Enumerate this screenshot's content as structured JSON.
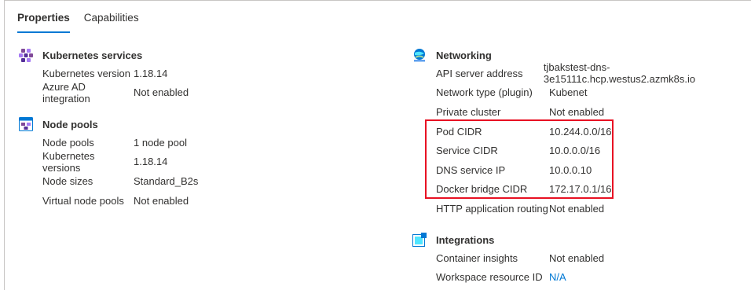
{
  "tabs": [
    {
      "label": "Properties",
      "active": true
    },
    {
      "label": "Capabilities",
      "active": false
    }
  ],
  "kubernetes_services": {
    "title": "Kubernetes services",
    "icon": "kubernetes-services-icon",
    "rows": [
      {
        "label": "Kubernetes version",
        "value": "1.18.14"
      },
      {
        "label": "Azure AD integration",
        "value": "Not enabled"
      }
    ]
  },
  "node_pools": {
    "title": "Node pools",
    "icon": "node-pools-icon",
    "rows": [
      {
        "label": "Node pools",
        "value": "1 node pool"
      },
      {
        "label": "Kubernetes versions",
        "value": "1.18.14"
      },
      {
        "label": "Node sizes",
        "value": "Standard_B2s"
      },
      {
        "label": "Virtual node pools",
        "value": "Not enabled"
      }
    ]
  },
  "networking": {
    "title": "Networking",
    "icon": "networking-icon",
    "rows": [
      {
        "label": "API server address",
        "value": "tjbakstest-dns-3e15111c.hcp.westus2.azmk8s.io"
      },
      {
        "label": "Network type (plugin)",
        "value": "Kubenet"
      },
      {
        "label": "Private cluster",
        "value": "Not enabled"
      },
      {
        "label": "Pod CIDR",
        "value": "10.244.0.0/16"
      },
      {
        "label": "Service CIDR",
        "value": "10.0.0.0/16"
      },
      {
        "label": "DNS service IP",
        "value": "10.0.0.10"
      },
      {
        "label": "Docker bridge CIDR",
        "value": "172.17.0.1/16"
      },
      {
        "label": "HTTP application routing",
        "value": "Not enabled"
      }
    ]
  },
  "integrations": {
    "title": "Integrations",
    "icon": "integrations-icon",
    "rows": [
      {
        "label": "Container insights",
        "value": "Not enabled"
      },
      {
        "label": "Workspace resource ID",
        "value": "N/A"
      }
    ]
  },
  "colors": {
    "accent": "#0078d4",
    "highlight_border": "#e81123",
    "text": "#323130"
  }
}
